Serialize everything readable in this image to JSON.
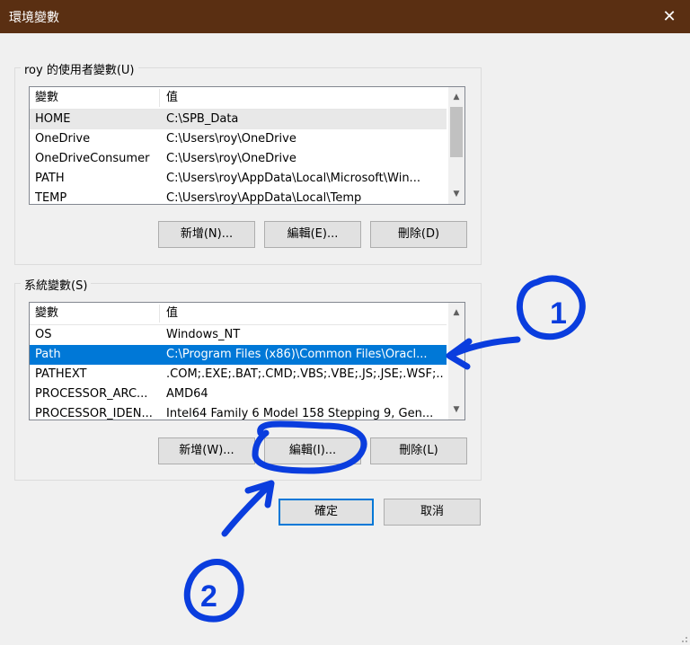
{
  "window": {
    "title": "環境變數"
  },
  "user_group": {
    "label": "roy 的使用者變數(U)",
    "columns": [
      "變數",
      "值"
    ],
    "rows": [
      {
        "name": "HOME",
        "value": "C:\\SPB_Data"
      },
      {
        "name": "OneDrive",
        "value": "C:\\Users\\roy\\OneDrive"
      },
      {
        "name": "OneDriveConsumer",
        "value": "C:\\Users\\roy\\OneDrive"
      },
      {
        "name": "PATH",
        "value": "C:\\Users\\roy\\AppData\\Local\\Microsoft\\Win..."
      },
      {
        "name": "TEMP",
        "value": "C:\\Users\\roy\\AppData\\Local\\Temp"
      }
    ],
    "buttons": {
      "new": "新增(N)...",
      "edit": "編輯(E)...",
      "delete": "刪除(D)"
    }
  },
  "system_group": {
    "label": "系統變數(S)",
    "columns": [
      "變數",
      "值"
    ],
    "rows": [
      {
        "name": "OS",
        "value": "Windows_NT"
      },
      {
        "name": "Path",
        "value": "C:\\Program Files (x86)\\Common Files\\Oracl..."
      },
      {
        "name": "PATHEXT",
        "value": ".COM;.EXE;.BAT;.CMD;.VBS;.VBE;.JS;.JSE;.WSF;...."
      },
      {
        "name": "PROCESSOR_ARC...",
        "value": "AMD64"
      },
      {
        "name": "PROCESSOR_IDEN...",
        "value": "Intel64 Family 6 Model 158 Stepping 9, Gen..."
      }
    ],
    "selected_row": "Path",
    "buttons": {
      "new": "新增(W)...",
      "edit": "編輯(I)...",
      "delete": "刪除(L)"
    }
  },
  "dialog_buttons": {
    "ok": "確定",
    "cancel": "取消"
  },
  "annotations": {
    "marker1": "1",
    "marker2": "2",
    "color": "#0a3dde"
  },
  "colors": {
    "titlebar": "#5a2f12",
    "selection": "#0078d7",
    "default_button_border": "#0078d7"
  }
}
